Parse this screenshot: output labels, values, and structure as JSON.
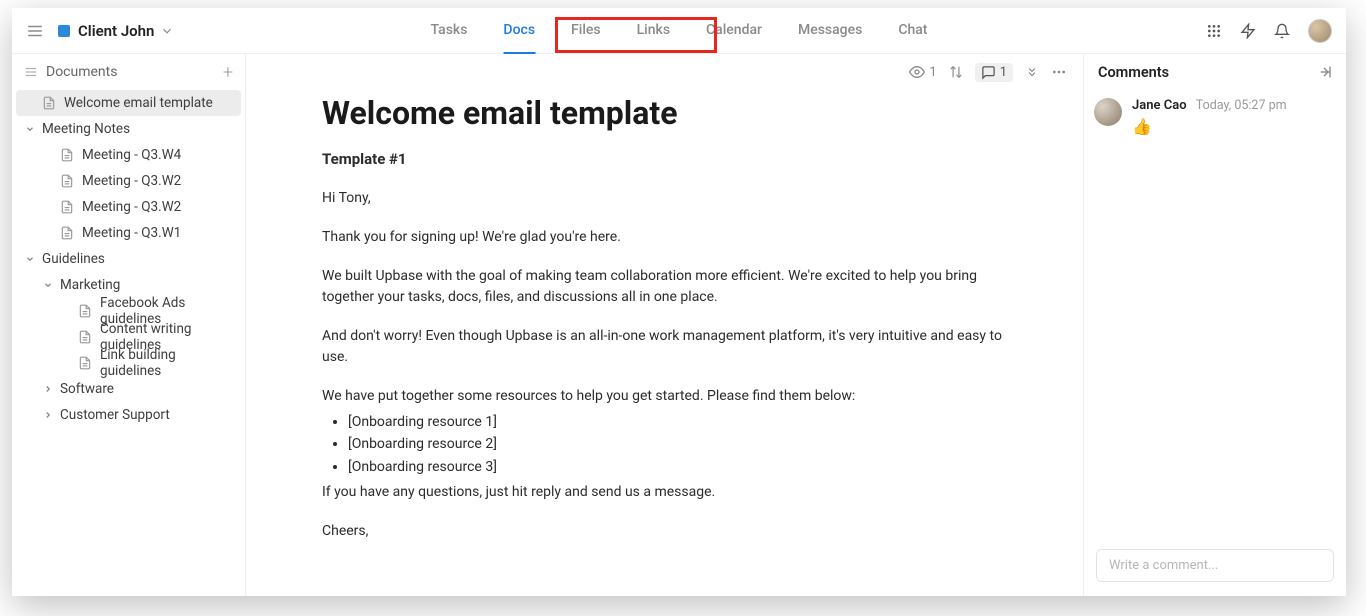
{
  "header": {
    "project_name": "Client John",
    "tabs": [
      "Tasks",
      "Docs",
      "Files",
      "Links",
      "Calendar",
      "Messages",
      "Chat"
    ],
    "active_tab": "Docs"
  },
  "sidebar": {
    "title": "Documents",
    "items": [
      {
        "label": "Welcome email template",
        "type": "doc",
        "depth": 0,
        "selected": true
      },
      {
        "label": "Meeting Notes",
        "type": "folder",
        "depth": 0,
        "expanded": true
      },
      {
        "label": "Meeting - Q3.W4",
        "type": "doc",
        "depth": 1
      },
      {
        "label": "Meeting - Q3.W2",
        "type": "doc",
        "depth": 1
      },
      {
        "label": "Meeting - Q3.W2",
        "type": "doc",
        "depth": 1
      },
      {
        "label": "Meeting - Q3.W1",
        "type": "doc",
        "depth": 1
      },
      {
        "label": "Guidelines",
        "type": "folder",
        "depth": 0,
        "expanded": true
      },
      {
        "label": "Marketing",
        "type": "folder",
        "depth": 1,
        "expanded": true
      },
      {
        "label": "Facebook Ads guidelines",
        "type": "doc",
        "depth": 2
      },
      {
        "label": "Content writing guidelines",
        "type": "doc",
        "depth": 2
      },
      {
        "label": "Link building guidelines",
        "type": "doc",
        "depth": 2
      },
      {
        "label": "Software",
        "type": "folder",
        "depth": 1,
        "expanded": false
      },
      {
        "label": "Customer Support",
        "type": "folder",
        "depth": 1,
        "expanded": false
      }
    ]
  },
  "doc": {
    "toolbar": {
      "views": "1",
      "comments": "1"
    },
    "title": "Welcome email template",
    "subhead": "Template #1",
    "p1": "Hi Tony,",
    "p2": "Thank you for signing up! We're glad you're here.",
    "p3": "We built Upbase with the goal of making team collaboration more efficient. We're excited to help you bring together your tasks, docs, files, and discussions all in one place.",
    "p4": "And don't worry! Even though Upbase is an all-in-one work management platform, it's very intuitive and easy to use.",
    "p5": "We have put together some resources to help you get started. Please find them below:",
    "bullets": [
      "[Onboarding resource 1]",
      "[Onboarding resource 2]",
      "[Onboarding resource 3]"
    ],
    "p6": "If you have any questions, just hit reply and send us a message.",
    "p7": "Cheers,"
  },
  "comments": {
    "title": "Comments",
    "items": [
      {
        "author": "Jane Cao",
        "time": "Today, 05:27 pm",
        "reaction": "👍"
      }
    ],
    "input_placeholder": "Write a comment..."
  }
}
